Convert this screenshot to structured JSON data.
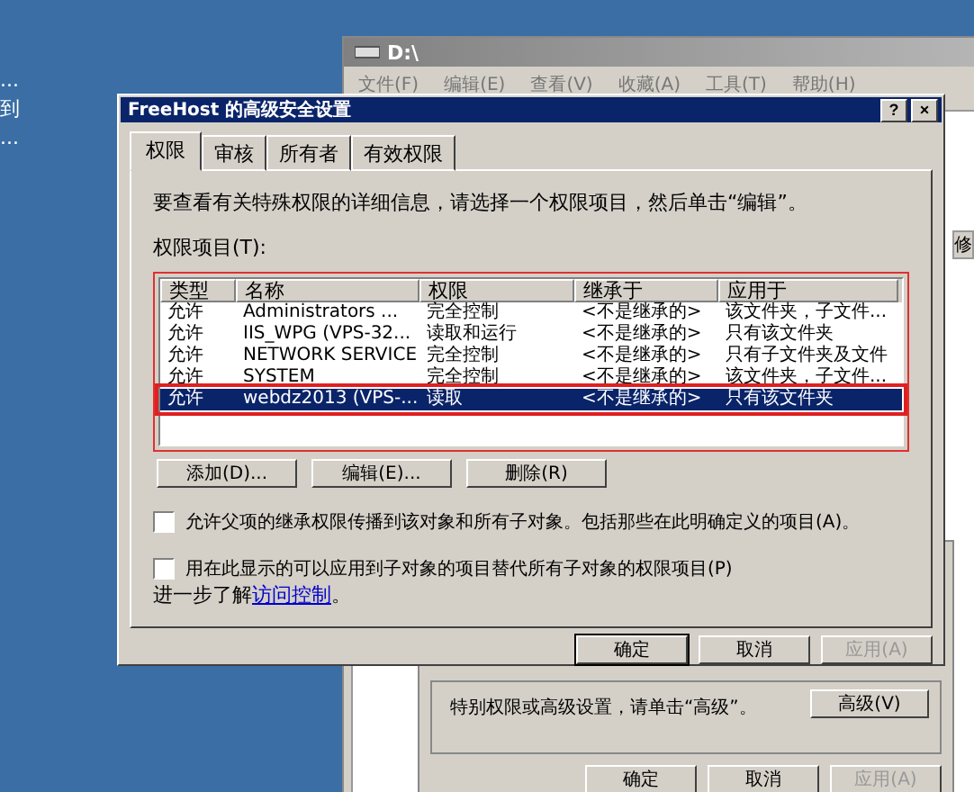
{
  "desktop": {
    "labels": [
      "...",
      "到",
      "..."
    ]
  },
  "explorer_window": {
    "title": "D:\\",
    "menu": [
      "文件(F)",
      "编辑(E)",
      "查看(V)",
      "收藏(A)",
      "工具(T)",
      "帮助(H)"
    ],
    "column_fragment": "修"
  },
  "properties_dialog": {
    "hint": "特别权限或高级设置，请单击“高级”。",
    "advanced_button": "高级(V)",
    "buttons": [
      {
        "label": "确定",
        "disabled": false,
        "default": false
      },
      {
        "label": "取消",
        "disabled": false,
        "default": false
      },
      {
        "label": "应用(A)",
        "disabled": true,
        "default": false
      }
    ]
  },
  "security_dialog": {
    "title": "FreeHost 的高级安全设置",
    "title_buttons": [
      "?",
      "×"
    ],
    "tabs": [
      {
        "label": "权限",
        "selected": true
      },
      {
        "label": "审核",
        "selected": false
      },
      {
        "label": "所有者",
        "selected": false
      },
      {
        "label": "有效权限",
        "selected": false
      }
    ],
    "intro": "要查看有关特殊权限的详细信息，请选择一个权限项目，然后单击“编辑”。",
    "list_label": "权限项目(T):",
    "table": {
      "columns": [
        "类型",
        "名称",
        "权限",
        "继承于",
        "应用于"
      ],
      "rows": [
        {
          "cells": [
            "允许",
            "Administrators ...",
            "完全控制",
            "<不是继承的>",
            "该文件夹，子文件..."
          ],
          "selected": false
        },
        {
          "cells": [
            "允许",
            "IIS_WPG (VPS-32...",
            "读取和运行",
            "<不是继承的>",
            "只有该文件夹"
          ],
          "selected": false
        },
        {
          "cells": [
            "允许",
            "NETWORK SERVICE",
            "完全控制",
            "<不是继承的>",
            "只有子文件夹及文件"
          ],
          "selected": false
        },
        {
          "cells": [
            "允许",
            "SYSTEM",
            "完全控制",
            "<不是继承的>",
            "该文件夹，子文件..."
          ],
          "selected": false
        },
        {
          "cells": [
            "允许",
            "webdz2013 (VPS-...",
            "读取",
            "<不是继承的>",
            "只有该文件夹"
          ],
          "selected": true
        }
      ]
    },
    "list_buttons": [
      "添加(D)...",
      "编辑(E)...",
      "删除(R)"
    ],
    "checkboxes": [
      {
        "label": "允许父项的继承权限传播到该对象和所有子对象。包括那些在此明确定义的项目(A)。",
        "checked": false
      },
      {
        "label": "用在此显示的可以应用到子对象的项目替代所有子对象的权限项目(P)",
        "checked": false
      }
    ],
    "learn_more": {
      "text": "进一步了解",
      "link": "访问控制",
      "end": "。"
    },
    "buttons": [
      {
        "label": "确定",
        "disabled": false,
        "default": true
      },
      {
        "label": "取消",
        "disabled": false,
        "default": false
      },
      {
        "label": "应用(A)",
        "disabled": true,
        "default": false
      }
    ]
  }
}
